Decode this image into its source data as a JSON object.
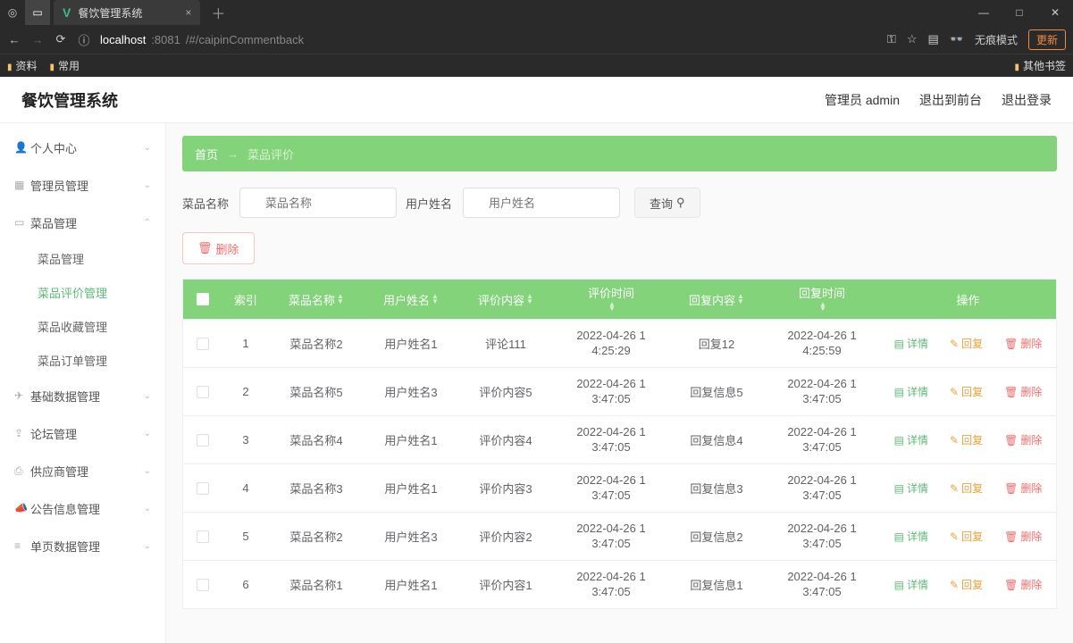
{
  "browser": {
    "tab_title": "餐饮管理系统",
    "url_host": "localhost",
    "url_port": ":8081",
    "url_path": "/#/caipinCommentback",
    "update": "更新",
    "incognito": "无痕模式",
    "bookmarks": {
      "b1": "资料",
      "b2": "常用",
      "other": "其他书签"
    }
  },
  "app": {
    "title": "餐饮管理系统",
    "admin_label": "管理员 admin",
    "exit_front": "退出到前台",
    "logout": "退出登录"
  },
  "sidebar": {
    "items": [
      {
        "label": "个人中心"
      },
      {
        "label": "管理员管理"
      },
      {
        "label": "菜品管理",
        "open": true,
        "children": [
          {
            "label": "菜品管理"
          },
          {
            "label": "菜品评价管理",
            "active": true
          },
          {
            "label": "菜品收藏管理"
          },
          {
            "label": "菜品订单管理"
          }
        ]
      },
      {
        "label": "基础数据管理"
      },
      {
        "label": "论坛管理"
      },
      {
        "label": "供应商管理"
      },
      {
        "label": "公告信息管理"
      },
      {
        "label": "单页数据管理"
      }
    ]
  },
  "breadcrumb": {
    "home": "首页",
    "current": "菜品评价"
  },
  "search": {
    "label_name": "菜品名称",
    "ph_name": "菜品名称",
    "label_user": "用户姓名",
    "ph_user": "用户姓名",
    "query": "查询"
  },
  "buttons": {
    "delete": "删除"
  },
  "table": {
    "headers": {
      "idx": "索引",
      "c1": "菜品名称",
      "c2": "用户姓名",
      "c3": "评价内容",
      "c4": "评价时间",
      "c5": "回复内容",
      "c6": "回复时间",
      "ops": "操作"
    },
    "ops": {
      "detail": "详情",
      "reply": "回复",
      "del": "删除"
    },
    "rows": [
      {
        "idx": "1",
        "c1": "菜品名称2",
        "c2": "用户姓名1",
        "c3": "评论111",
        "c4a": "2022-04-26 1",
        "c4b": "4:25:29",
        "c5": "回复12",
        "c6a": "2022-04-26 1",
        "c6b": "4:25:59"
      },
      {
        "idx": "2",
        "c1": "菜品名称5",
        "c2": "用户姓名3",
        "c3": "评价内容5",
        "c4a": "2022-04-26 1",
        "c4b": "3:47:05",
        "c5": "回复信息5",
        "c6a": "2022-04-26 1",
        "c6b": "3:47:05"
      },
      {
        "idx": "3",
        "c1": "菜品名称4",
        "c2": "用户姓名1",
        "c3": "评价内容4",
        "c4a": "2022-04-26 1",
        "c4b": "3:47:05",
        "c5": "回复信息4",
        "c6a": "2022-04-26 1",
        "c6b": "3:47:05"
      },
      {
        "idx": "4",
        "c1": "菜品名称3",
        "c2": "用户姓名1",
        "c3": "评价内容3",
        "c4a": "2022-04-26 1",
        "c4b": "3:47:05",
        "c5": "回复信息3",
        "c6a": "2022-04-26 1",
        "c6b": "3:47:05"
      },
      {
        "idx": "5",
        "c1": "菜品名称2",
        "c2": "用户姓名3",
        "c3": "评价内容2",
        "c4a": "2022-04-26 1",
        "c4b": "3:47:05",
        "c5": "回复信息2",
        "c6a": "2022-04-26 1",
        "c6b": "3:47:05"
      },
      {
        "idx": "6",
        "c1": "菜品名称1",
        "c2": "用户姓名1",
        "c3": "评价内容1",
        "c4a": "2022-04-26 1",
        "c4b": "3:47:05",
        "c5": "回复信息1",
        "c6a": "2022-04-26 1",
        "c6b": "3:47:05"
      }
    ]
  }
}
